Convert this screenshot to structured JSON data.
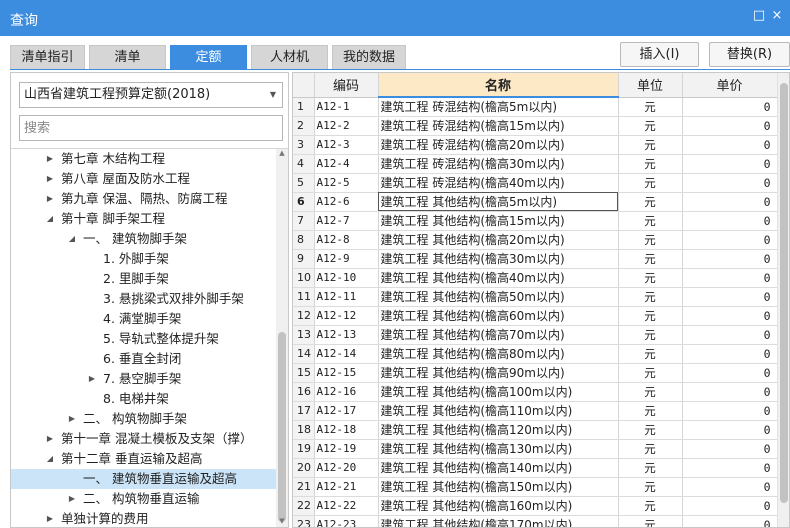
{
  "window": {
    "title": "查询",
    "restore_icon": "□",
    "close_icon": "×"
  },
  "tabs": [
    {
      "label": "清单指引",
      "active": false
    },
    {
      "label": "清单",
      "active": false
    },
    {
      "label": "定额",
      "active": true
    },
    {
      "label": "人材机",
      "active": false
    },
    {
      "label": "我的数据",
      "active": false
    }
  ],
  "actions": {
    "insert_label": "插入(I)",
    "replace_label": "替换(R)"
  },
  "left": {
    "quota_select": "山西省建筑工程预算定额(2018)",
    "search_placeholder": "搜索",
    "tree": [
      {
        "label": "第七章 木结构工程",
        "level": 0,
        "expander": "▶",
        "selected": false
      },
      {
        "label": "第八章 屋面及防水工程",
        "level": 0,
        "expander": "▶",
        "selected": false
      },
      {
        "label": "第九章 保温、隔热、防腐工程",
        "level": 0,
        "expander": "▶",
        "selected": false
      },
      {
        "label": "第十章 脚手架工程",
        "level": 0,
        "expander": "◢",
        "selected": false
      },
      {
        "label": "一、 建筑物脚手架",
        "level": 1,
        "expander": "◢",
        "selected": false
      },
      {
        "label": "1. 外脚手架",
        "level": 2,
        "expander": "",
        "selected": false
      },
      {
        "label": "2. 里脚手架",
        "level": 2,
        "expander": "",
        "selected": false
      },
      {
        "label": "3. 悬挑梁式双排外脚手架",
        "level": 2,
        "expander": "",
        "selected": false
      },
      {
        "label": "4. 满堂脚手架",
        "level": 2,
        "expander": "",
        "selected": false
      },
      {
        "label": "5. 导轨式整体提升架",
        "level": 2,
        "expander": "",
        "selected": false
      },
      {
        "label": "6. 垂直全封闭",
        "level": 2,
        "expander": "",
        "selected": false
      },
      {
        "label": "7. 悬空脚手架",
        "level": 2,
        "expander": "▶",
        "selected": false
      },
      {
        "label": "8. 电梯井架",
        "level": 2,
        "expander": "",
        "selected": false
      },
      {
        "label": "二、 构筑物脚手架",
        "level": 1,
        "expander": "▶",
        "selected": false
      },
      {
        "label": "第十一章 混凝土模板及支架（撑）",
        "level": 0,
        "expander": "▶",
        "selected": false
      },
      {
        "label": "第十二章 垂直运输及超高",
        "level": 0,
        "expander": "◢",
        "selected": false
      },
      {
        "label": "一、 建筑物垂直运输及超高",
        "level": 1,
        "expander": "",
        "selected": true
      },
      {
        "label": "二、 构筑物垂直运输",
        "level": 1,
        "expander": "▶",
        "selected": false
      },
      {
        "label": "单独计算的费用",
        "level": 0,
        "expander": "▶",
        "selected": false
      }
    ]
  },
  "grid": {
    "headers": {
      "code": "编码",
      "name": "名称",
      "unit": "单位",
      "price": "单价"
    },
    "current_row": 6,
    "rows": [
      {
        "n": "1",
        "code": "A12-1",
        "name": "建筑工程 砖混结构(檐高5m以内)",
        "unit": "元",
        "price": "0"
      },
      {
        "n": "2",
        "code": "A12-2",
        "name": "建筑工程 砖混结构(檐高15m以内)",
        "unit": "元",
        "price": "0"
      },
      {
        "n": "3",
        "code": "A12-3",
        "name": "建筑工程 砖混结构(檐高20m以内)",
        "unit": "元",
        "price": "0"
      },
      {
        "n": "4",
        "code": "A12-4",
        "name": "建筑工程 砖混结构(檐高30m以内)",
        "unit": "元",
        "price": "0"
      },
      {
        "n": "5",
        "code": "A12-5",
        "name": "建筑工程 砖混结构(檐高40m以内)",
        "unit": "元",
        "price": "0"
      },
      {
        "n": "6",
        "code": "A12-6",
        "name": "建筑工程 其他结构(檐高5m以内)",
        "unit": "元",
        "price": "0"
      },
      {
        "n": "7",
        "code": "A12-7",
        "name": "建筑工程 其他结构(檐高15m以内)",
        "unit": "元",
        "price": "0"
      },
      {
        "n": "8",
        "code": "A12-8",
        "name": "建筑工程 其他结构(檐高20m以内)",
        "unit": "元",
        "price": "0"
      },
      {
        "n": "9",
        "code": "A12-9",
        "name": "建筑工程 其他结构(檐高30m以内)",
        "unit": "元",
        "price": "0"
      },
      {
        "n": "10",
        "code": "A12-10",
        "name": "建筑工程 其他结构(檐高40m以内)",
        "unit": "元",
        "price": "0"
      },
      {
        "n": "11",
        "code": "A12-11",
        "name": "建筑工程 其他结构(檐高50m以内)",
        "unit": "元",
        "price": "0"
      },
      {
        "n": "12",
        "code": "A12-12",
        "name": "建筑工程 其他结构(檐高60m以内)",
        "unit": "元",
        "price": "0"
      },
      {
        "n": "13",
        "code": "A12-13",
        "name": "建筑工程 其他结构(檐高70m以内)",
        "unit": "元",
        "price": "0"
      },
      {
        "n": "14",
        "code": "A12-14",
        "name": "建筑工程 其他结构(檐高80m以内)",
        "unit": "元",
        "price": "0"
      },
      {
        "n": "15",
        "code": "A12-15",
        "name": "建筑工程 其他结构(檐高90m以内)",
        "unit": "元",
        "price": "0"
      },
      {
        "n": "16",
        "code": "A12-16",
        "name": "建筑工程 其他结构(檐高100m以内)",
        "unit": "元",
        "price": "0"
      },
      {
        "n": "17",
        "code": "A12-17",
        "name": "建筑工程 其他结构(檐高110m以内)",
        "unit": "元",
        "price": "0"
      },
      {
        "n": "18",
        "code": "A12-18",
        "name": "建筑工程 其他结构(檐高120m以内)",
        "unit": "元",
        "price": "0"
      },
      {
        "n": "19",
        "code": "A12-19",
        "name": "建筑工程 其他结构(檐高130m以内)",
        "unit": "元",
        "price": "0"
      },
      {
        "n": "20",
        "code": "A12-20",
        "name": "建筑工程 其他结构(檐高140m以内)",
        "unit": "元",
        "price": "0"
      },
      {
        "n": "21",
        "code": "A12-21",
        "name": "建筑工程 其他结构(檐高150m以内)",
        "unit": "元",
        "price": "0"
      },
      {
        "n": "22",
        "code": "A12-22",
        "name": "建筑工程 其他结构(檐高160m以内)",
        "unit": "元",
        "price": "0"
      },
      {
        "n": "23",
        "code": "A12-23",
        "name": "建筑工程 其他结构(檐高170m以内)",
        "unit": "元",
        "price": "0"
      }
    ]
  },
  "colors": {
    "accent": "#3c8ce0",
    "name_header_bg": "#fde9c6",
    "selected_bg": "#cce4f7"
  }
}
